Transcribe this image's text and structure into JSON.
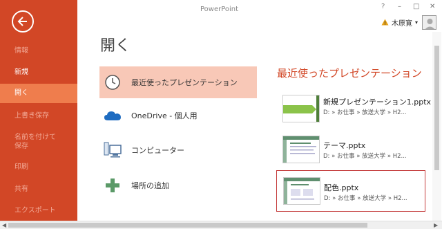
{
  "app": {
    "title": "PowerPoint"
  },
  "window": {
    "help": "?",
    "minimize": "–",
    "restore": "□",
    "close": "✕"
  },
  "user": {
    "name": "木原寛",
    "dropdown": "▾"
  },
  "sidebar": {
    "items": [
      {
        "label": "情報"
      },
      {
        "label": "新規"
      },
      {
        "label": "開く"
      },
      {
        "label": "上書き保存"
      },
      {
        "label": "名前を付けて\n保存"
      },
      {
        "label": "印刷"
      },
      {
        "label": "共有"
      },
      {
        "label": "エクスポート"
      }
    ]
  },
  "page": {
    "title": "開く"
  },
  "locations": [
    {
      "label": "最近使ったプレゼンテーション",
      "icon": "clock-icon"
    },
    {
      "label": "OneDrive - 個人用",
      "icon": "cloud-icon"
    },
    {
      "label": "コンピューター",
      "icon": "computer-icon"
    },
    {
      "label": "場所の追加",
      "icon": "plus-icon"
    }
  ],
  "recent": {
    "heading": "最近使ったプレゼンテーション",
    "files": [
      {
        "name": "新規プレゼンテーション1.pptx",
        "path": "D: » お仕事 » 放送大学 » H2..."
      },
      {
        "name": "テーマ.pptx",
        "path": "D: » お仕事 » 放送大学 » H2..."
      },
      {
        "name": "配色.pptx",
        "path": "D: » お仕事 » 放送大学 » H2..."
      }
    ]
  },
  "colors": {
    "accent": "#d24726",
    "active": "#ef7d4d",
    "selected_bg": "#f8c8b7"
  }
}
